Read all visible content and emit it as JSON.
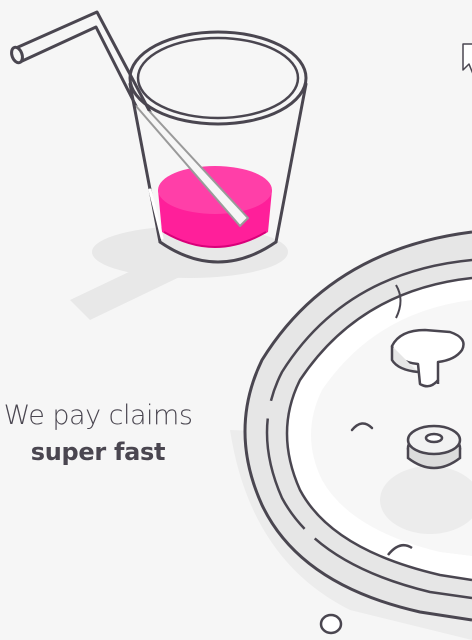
{
  "headline": {
    "line1": "We pay claims",
    "line2": "super fast"
  },
  "colors": {
    "background": "#f6f6f6",
    "outline": "#4a4650",
    "juice": "#ff1f9a",
    "shadow": "#e6e6e6",
    "ring": "#e4e4e4"
  },
  "icons": {
    "cursor": "mouse-pointer-icon"
  }
}
